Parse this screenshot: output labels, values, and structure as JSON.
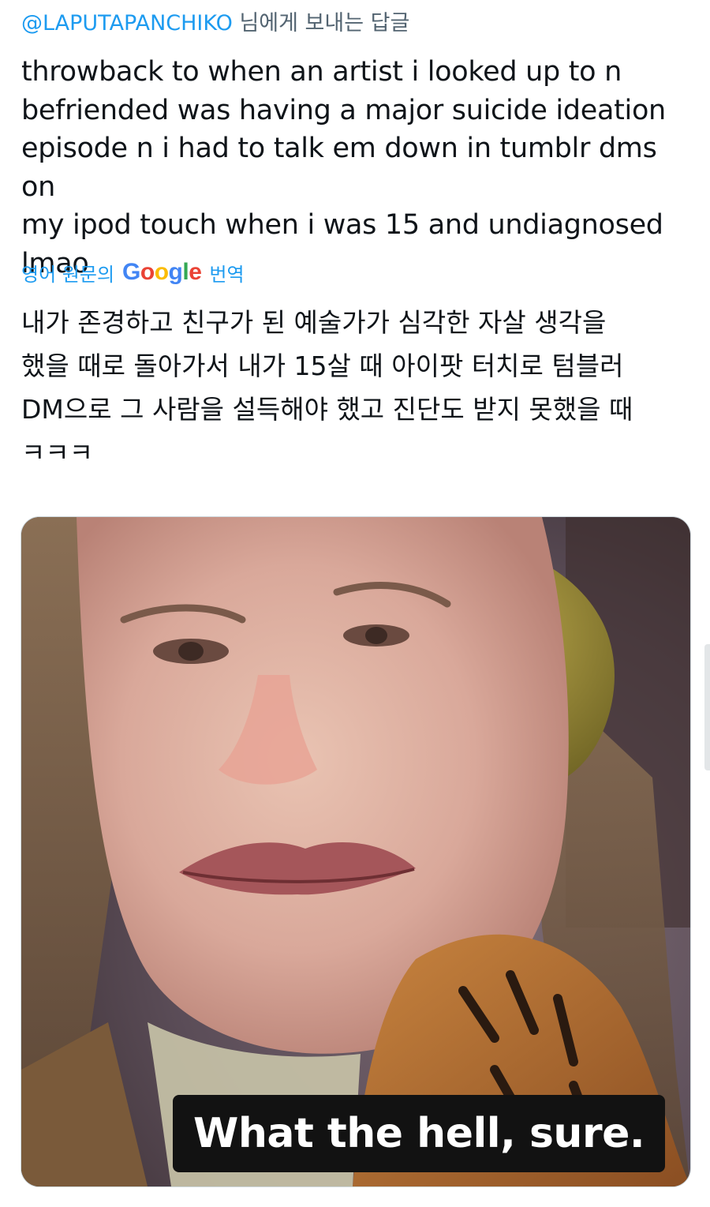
{
  "reply": {
    "handle": "@LAPUTAPANCHIKO",
    "suffix": " 님에게 보내는 답글"
  },
  "tweet": {
    "text": "throwback to when an artist i looked up to n\nbefriended was having a major suicide ideation\nepisode n i had to talk em down in tumblr dms on\nmy ipod touch when i was 15 and undiagnosed\nlmao"
  },
  "translation": {
    "from_label": "영어 원문의",
    "provider_logo_text": "Google",
    "action_label": "번역",
    "text": "내가 존경하고 친구가 된 예술가가 심각한 자살 생각을\n했을 때로 돌아가서 내가 15살 때 아이팟 터치로 텀블러\nDM으로 그 사람을 설득해야 했고 진단도 받지 못했을 때\nㅋㅋㅋ"
  },
  "media": {
    "caption": "What the hell, sure."
  },
  "colors": {
    "link_blue": "#1d9bf0",
    "secondary_text": "#536471",
    "primary_text": "#0f1419",
    "caption_background": "#121212"
  },
  "icons": {
    "google_logo": "google-logo-icon"
  }
}
